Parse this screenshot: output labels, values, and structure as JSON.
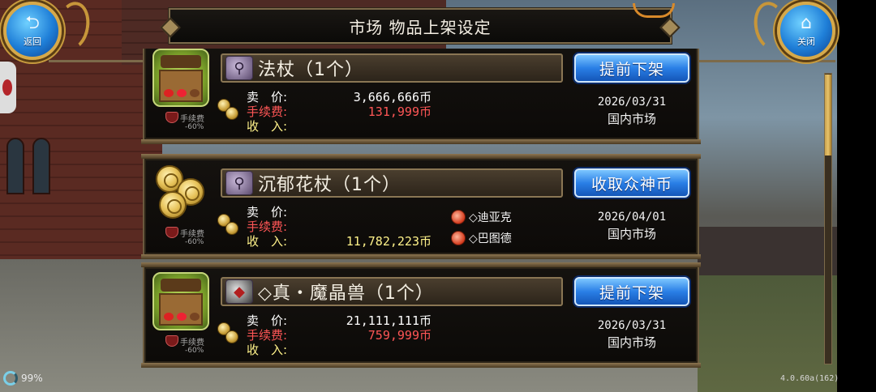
{
  "header": {
    "title": "市场 物品上架设定"
  },
  "buttons": {
    "back_label": "返回",
    "close_label": "关闭"
  },
  "listings": [
    {
      "item_name": "法杖（1个）",
      "thumbnail": "market-stall",
      "fee_badge": {
        "label": "手续费",
        "pct": "-60%"
      },
      "price_label": "卖　价:",
      "price": "3,666,666币",
      "fee_label": "手续费:",
      "fee": "131,999币",
      "income_label": "收　入:",
      "income": "",
      "action": "提前下架",
      "date": "2026/03/31",
      "market": "国内市场"
    },
    {
      "item_name": "沉郁花杖（1个）",
      "thumbnail": "coins",
      "fee_badge": {
        "label": "手续费",
        "pct": "-60%"
      },
      "price_label": "卖　价:",
      "price": "",
      "fee_label": "手续费:",
      "fee": "",
      "income_label": "收　入:",
      "income": "11,782,223币",
      "buyers": [
        "◇迪亚克",
        "◇巴图德"
      ],
      "action": "收取众神币",
      "date": "2026/04/01",
      "market": "国内市场"
    },
    {
      "item_name": "◇真・魔晶兽（1个）",
      "thumbnail": "market-stall",
      "fee_badge": {
        "label": "手续费",
        "pct": "-60%"
      },
      "price_label": "卖　价:",
      "price": "21,111,111币",
      "fee_label": "手续费:",
      "fee": "759,999币",
      "income_label": "收　入:",
      "income": "",
      "action": "提前下架",
      "date": "2026/03/31",
      "market": "国内市场"
    }
  ],
  "status": {
    "battery": "99%",
    "version": "4.0.60a(162)"
  },
  "colors": {
    "price": "#ffffff",
    "fee": "#ff5656",
    "income": "#fff28a",
    "button": "#2a7fe6"
  }
}
